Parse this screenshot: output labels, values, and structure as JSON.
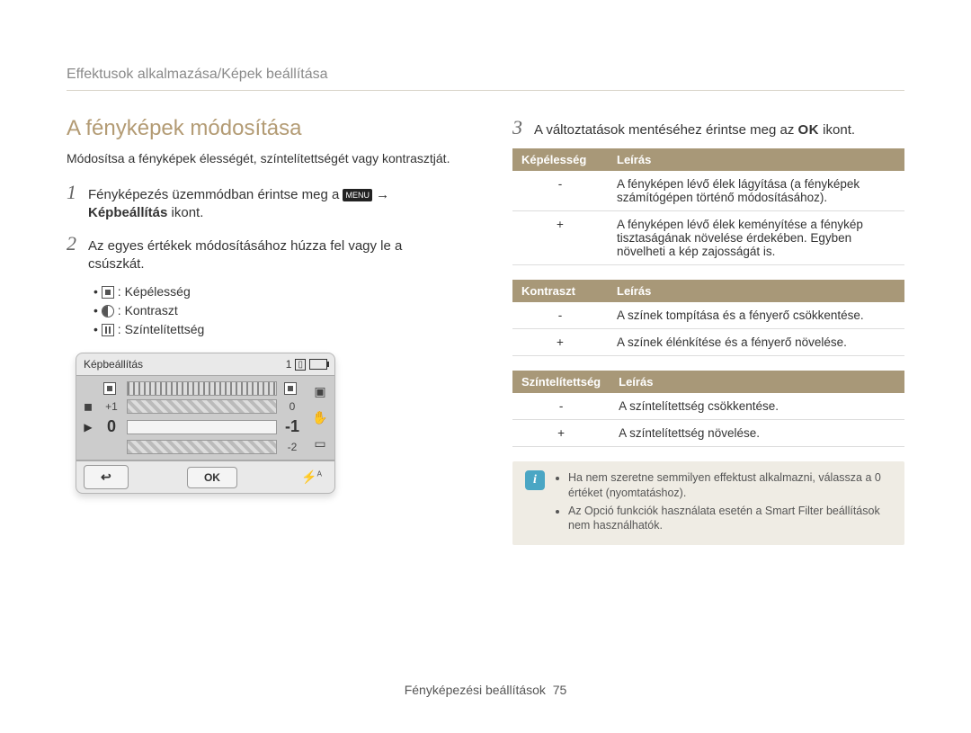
{
  "breadcrumb": "Effektusok alkalmazása/Képek beállítása",
  "left": {
    "title": "A fényképek módosítása",
    "intro": "Módosítsa a fényképek élességét, színtelítettségét vagy kontrasztját.",
    "step1_pre": "Fényképezés üzemmódban érintse meg a ",
    "step1_menu": "MENU",
    "step1_arrow": " → ",
    "step1_bold": "Képbeállítás",
    "step1_post": " ikont.",
    "step2": "Az egyes értékek módosításához húzza fel vagy le a csúszkát.",
    "bullets": [
      {
        "icon": "sharp",
        "label": ": Képélesség"
      },
      {
        "icon": "contrast",
        "label": ": Kontraszt"
      },
      {
        "icon": "sat",
        "label": ": Színtelítettség"
      }
    ],
    "camera": {
      "title": "Képbeállítás",
      "count": "1",
      "rows": [
        {
          "lead": "◼",
          "left": "",
          "val_l": "",
          "val_r": "",
          "icon_r": "◼"
        },
        {
          "lead": "◼",
          "left": "+1",
          "val_l": "+1",
          "val_r": "0"
        },
        {
          "lead": "▶",
          "left": "0",
          "val_l": "0",
          "val_r": "-1",
          "current": true
        },
        {
          "lead": "",
          "left": "",
          "val_l": "",
          "val_r": "-2"
        }
      ],
      "ok": "OK"
    }
  },
  "right": {
    "step3_pre": "A változtatások mentéséhez érintse meg az ",
    "step3_ok": "OK",
    "step3_post": " ikont.",
    "tables": [
      {
        "head_a": "Képélesség",
        "head_b": "Leírás",
        "rows": [
          {
            "k": "-",
            "v": "A fényképen lévő élek lágyítása (a fényképek számítógépen történő módosításához)."
          },
          {
            "k": "+",
            "v": "A fényképen lévő élek keményítése a fénykép tisztaságának növelése érdekében. Egyben növelheti a kép zajosságát is."
          }
        ]
      },
      {
        "head_a": "Kontraszt",
        "head_b": "Leírás",
        "rows": [
          {
            "k": "-",
            "v": "A színek tompítása és a fényerő csökkentése."
          },
          {
            "k": "+",
            "v": "A színek élénkítése és a fényerő növelése."
          }
        ]
      },
      {
        "head_a": "Színtelítettség",
        "head_b": "Leírás",
        "rows": [
          {
            "k": "-",
            "v": "A színtelítettség csökkentése."
          },
          {
            "k": "+",
            "v": "A színtelítettség növelése."
          }
        ]
      }
    ],
    "notes": [
      "Ha nem szeretne semmilyen effektust alkalmazni, válassza a 0 értéket (nyomtatáshoz).",
      "Az Opció funkciók használata esetén a Smart Filter beállítások nem használhatók."
    ]
  },
  "footer_label": "Fényképezési beállítások",
  "footer_page": "75"
}
